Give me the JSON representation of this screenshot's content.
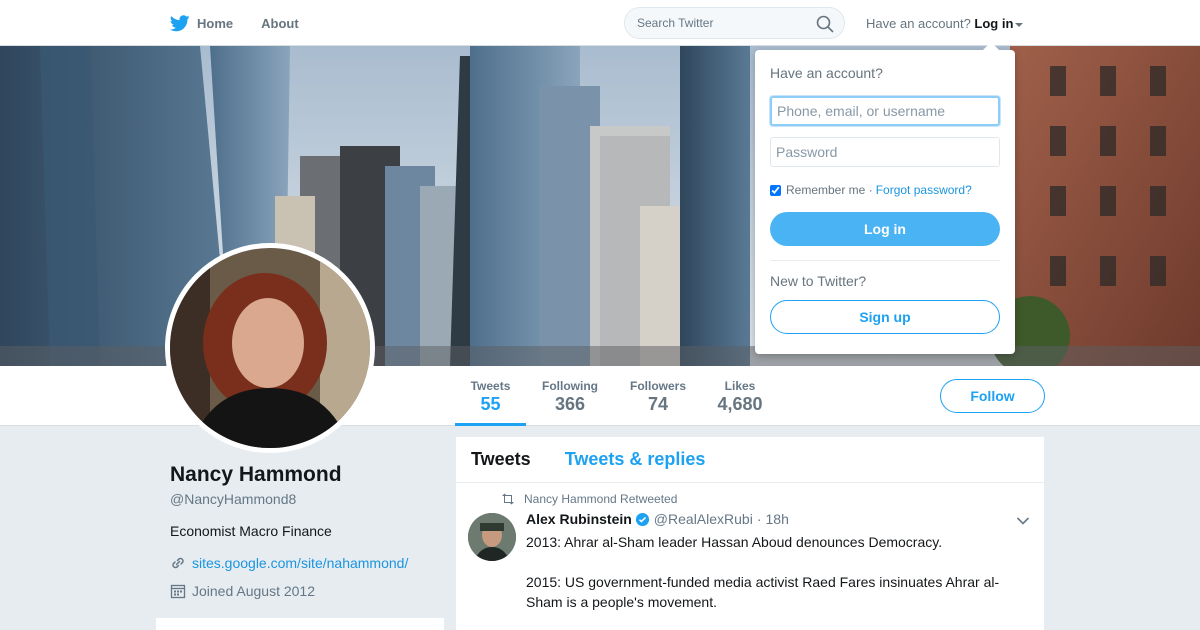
{
  "nav": {
    "home_label": "Home",
    "about_label": "About",
    "search_placeholder": "Search Twitter",
    "have_account": "Have an account?",
    "login_label": "Log in"
  },
  "login_dropdown": {
    "title": "Have an account?",
    "username_placeholder": "Phone, email, or username",
    "password_placeholder": "Password",
    "remember_label": "Remember me",
    "separator": "·",
    "forgot_label": "Forgot password?",
    "login_button": "Log in",
    "new_label": "New to Twitter?",
    "signup_button": "Sign up",
    "remember_checked": true
  },
  "profile": {
    "name": "Nancy Hammond",
    "handle": "@NancyHammond8",
    "bio": "Economist Macro Finance",
    "website": "sites.google.com/site/nahammond/",
    "joined": "Joined August 2012"
  },
  "stats": [
    {
      "label": "Tweets",
      "value": "55"
    },
    {
      "label": "Following",
      "value": "366"
    },
    {
      "label": "Followers",
      "value": "74"
    },
    {
      "label": "Likes",
      "value": "4,680"
    }
  ],
  "follow_button": "Follow",
  "timeline": {
    "tabs": [
      "Tweets",
      "Tweets & replies"
    ],
    "tweet": {
      "context": "Nancy Hammond Retweeted",
      "author_name": "Alex Rubinstein",
      "author_handle": "@RealAlexRubi",
      "dot": "·",
      "time": "18h",
      "text": "2013: Ahrar al-Sham leader Hassan Aboud denounces Democracy.\n\n2015: US government-funded media activist Raed Fares insinuates Ahrar al-Sham is a people's movement."
    }
  },
  "colors": {
    "brand": "#1da1f2",
    "login_button": "#4ab3f4",
    "link": "#1b95e0"
  },
  "icons": [
    "twitter-bird-icon",
    "search-icon",
    "caret-down-icon",
    "link-icon",
    "calendar-icon",
    "retweet-icon",
    "verified-badge-icon",
    "chevron-down-icon"
  ]
}
